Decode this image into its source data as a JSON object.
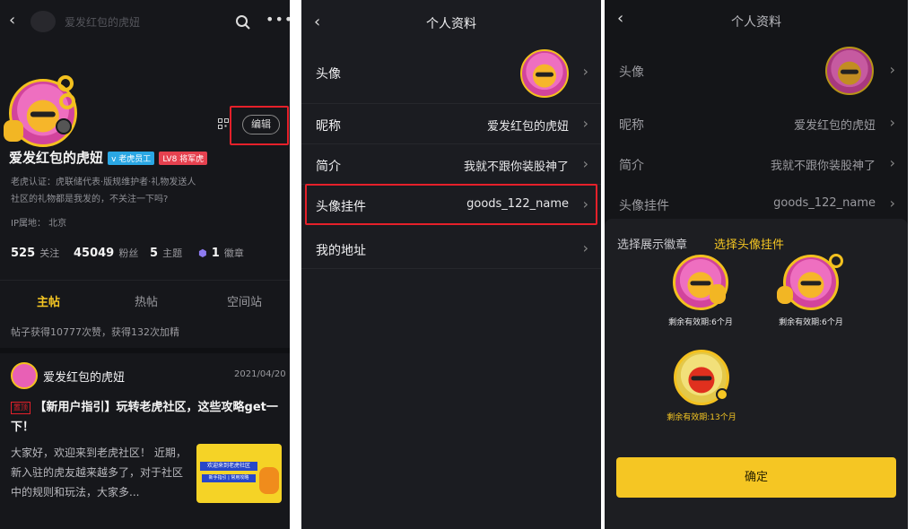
{
  "s1": {
    "header_name": "爱发红包的虎妞",
    "edit_label": "编辑",
    "name": "爱发红包的虎妞",
    "badge_staff": "v 老虎员工",
    "badge_level": "LV8 将军虎",
    "bio_line1": "老虎认证：虎联储代表·版规维护者·礼物发送人",
    "bio_line2": "社区的礼物都是我发的，不关注一下吗?",
    "ip_location": "IP属地： 北京",
    "stats": [
      {
        "num": "525",
        "label": "关注"
      },
      {
        "num": "45049",
        "label": "粉丝"
      },
      {
        "num": "5",
        "label": "主题"
      },
      {
        "num": "1",
        "label": "徽章"
      }
    ],
    "tabs": [
      "主帖",
      "热帖",
      "空间站"
    ],
    "summary": "帖子获得10777次赞，获得132次加精",
    "post": {
      "author": "爱发红包的虎妞",
      "date": "2021/04/20",
      "tag": "置顶",
      "title": "【新用户指引】玩转老虎社区，这些攻略get一下！",
      "body": "大家好，欢迎来到老虎社区！ 近期，新入驻的虎友越来越多了，对于社区中的规则和玩法，大家多...",
      "thumb_line1": "欢迎来到老虎社区",
      "thumb_line2": "新手指引 | 常用攻略"
    }
  },
  "s2": {
    "title": "个人资料",
    "rows": [
      {
        "label": "头像",
        "value": ""
      },
      {
        "label": "昵称",
        "value": "爱发红包的虎妞"
      },
      {
        "label": "简介",
        "value": "我就不跟你装股神了"
      },
      {
        "label": "头像挂件",
        "value": "goods_122_name"
      },
      {
        "label": "我的地址",
        "value": ""
      }
    ]
  },
  "s3": {
    "title": "个人资料",
    "rows": [
      {
        "label": "头像",
        "value": ""
      },
      {
        "label": "昵称",
        "value": "爱发红包的虎妞"
      },
      {
        "label": "简介",
        "value": "我就不跟你装股神了"
      },
      {
        "label": "头像挂件",
        "value": "goods_122_name"
      }
    ],
    "sheet_tab1": "选择展示徽章",
    "sheet_tab2": "选择头像挂件",
    "pendants": [
      {
        "caption": "剩余有效期:6个月"
      },
      {
        "caption": "剩余有效期:6个月"
      },
      {
        "caption": "剩余有效期:13个月"
      }
    ],
    "confirm_label": "确定"
  },
  "colors": {
    "accent_yellow": "#f5c623",
    "highlight_red": "#e5202a",
    "bg_dark": "#16171b"
  }
}
